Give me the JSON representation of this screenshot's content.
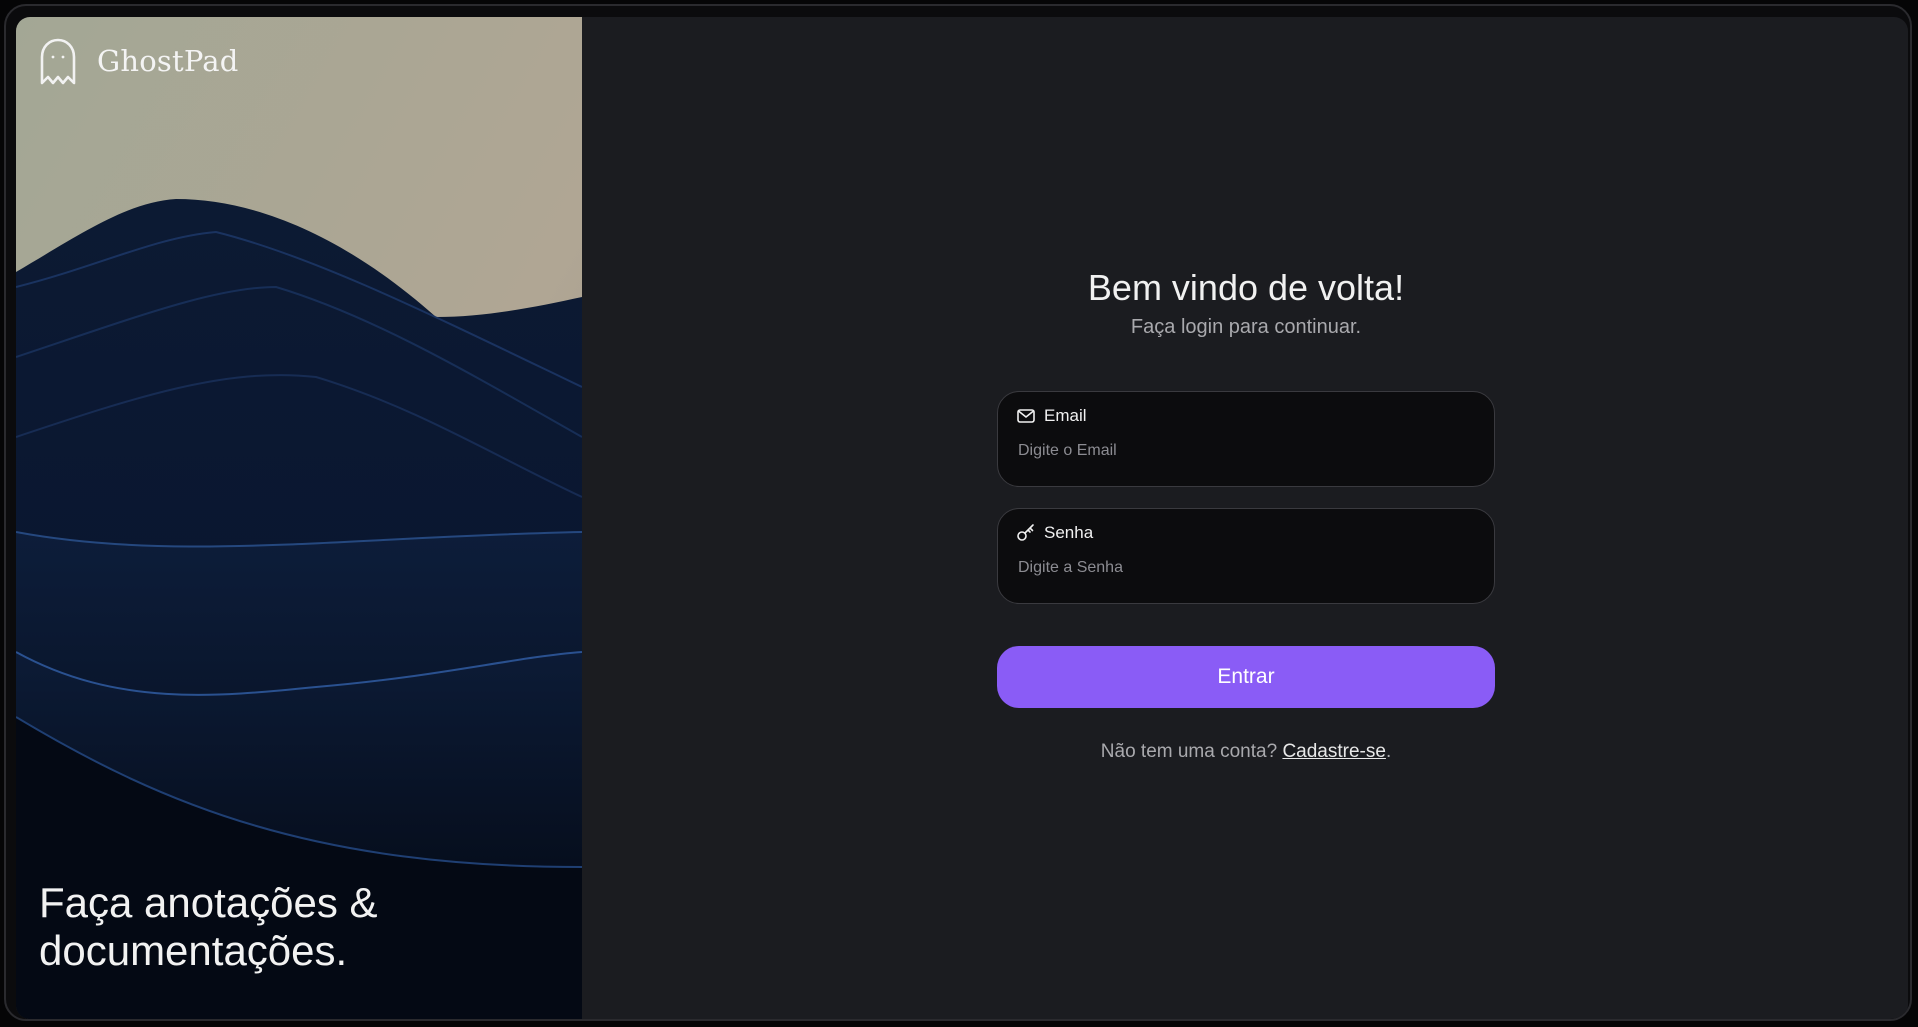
{
  "app": {
    "name": "GhostPad",
    "tagline": "Faça anotações &\ndocumentações."
  },
  "login": {
    "title": "Bem vindo de volta!",
    "subtitle": "Faça login para continuar.",
    "email": {
      "label": "Email",
      "placeholder": "Digite o Email",
      "icon": "mail-icon"
    },
    "password": {
      "label": "Senha",
      "placeholder": "Digite a Senha",
      "icon": "key-icon"
    },
    "submit_label": "Entrar",
    "signup_prompt": "Não tem uma conta? ",
    "signup_link": "Cadastre-se",
    "signup_suffix": "."
  },
  "colors": {
    "accent": "#8a5cf6",
    "panel_bg": "#1b1c20",
    "field_bg": "#0c0c0e"
  }
}
